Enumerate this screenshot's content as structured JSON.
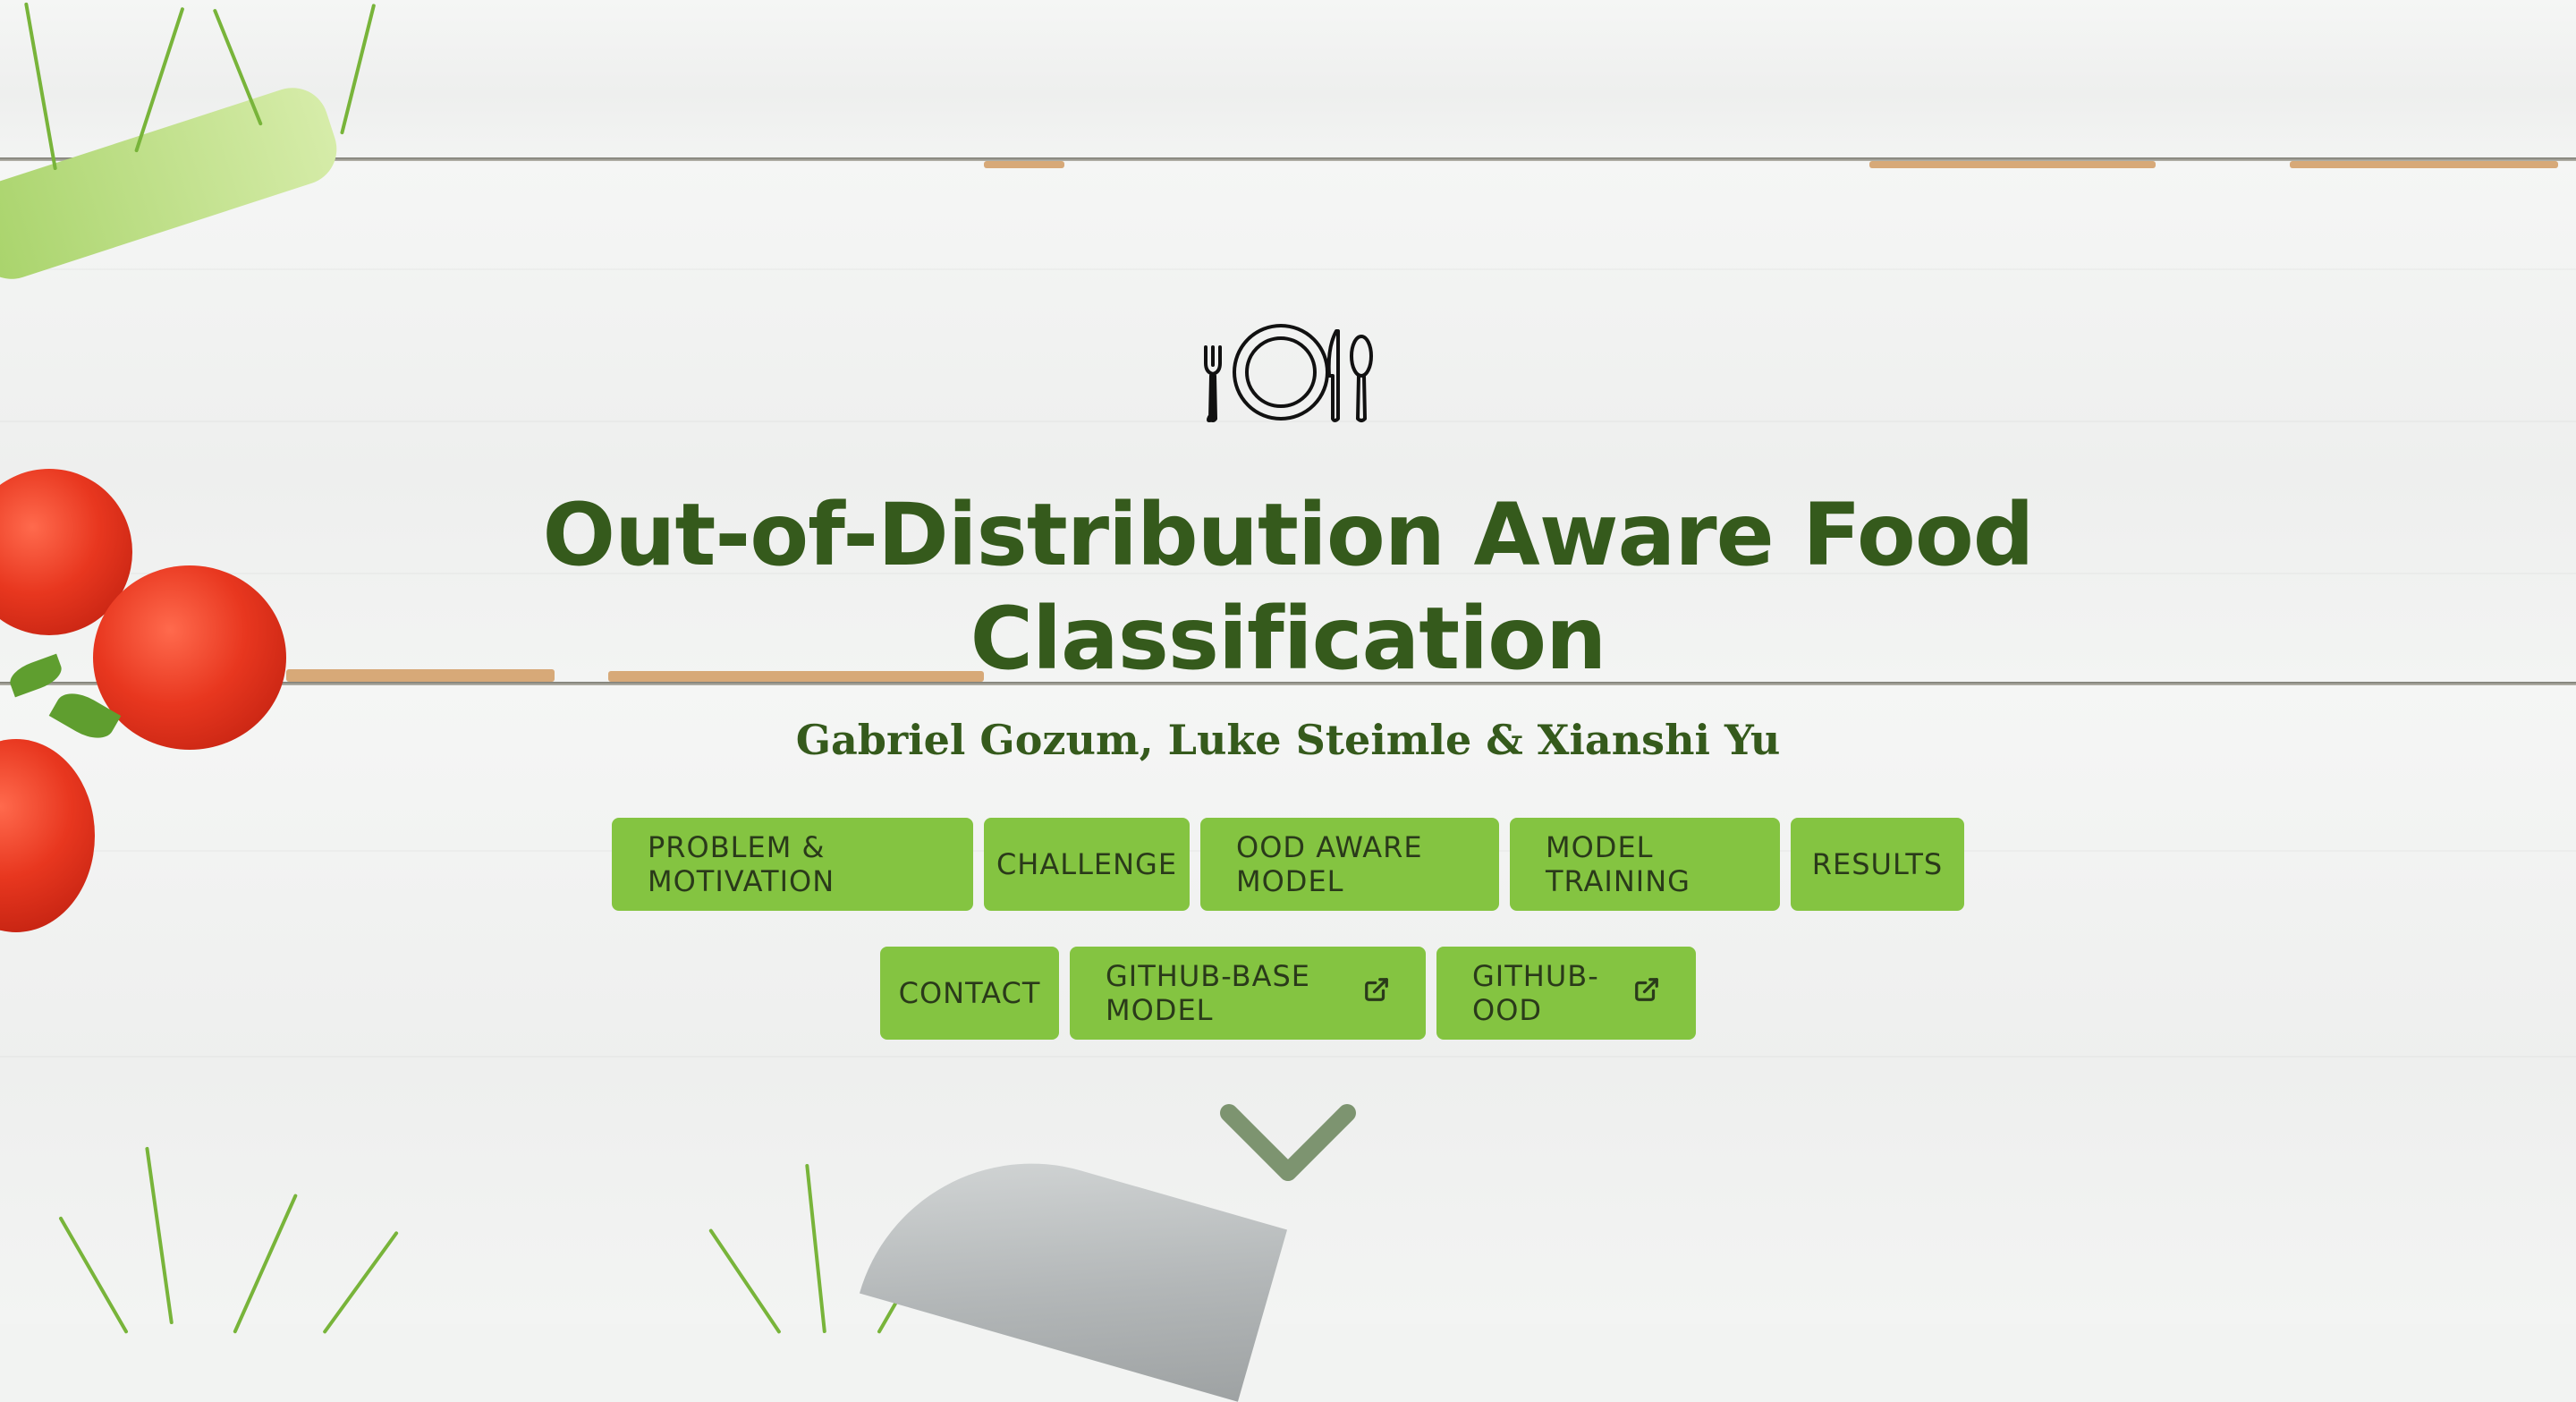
{
  "hero": {
    "logo_icon": "plate-fork-spoon-icon",
    "title_line1": "Out-of-Distribution Aware Food",
    "title_line2": "Classification",
    "authors": "Gabriel Gozum, Luke Steimle & Xianshi Yu",
    "scroll_icon": "chevron-down-icon"
  },
  "nav": {
    "row1": [
      {
        "label": "PROBLEM & MOTIVATION"
      },
      {
        "label": "CHALLENGE"
      },
      {
        "label": "OOD AWARE MODEL"
      },
      {
        "label": "MODEL TRAINING"
      },
      {
        "label": "RESULTS"
      }
    ],
    "row2": [
      {
        "label": "CONTACT"
      },
      {
        "label": "GITHUB-BASE MODEL",
        "icon": "external-link-icon"
      },
      {
        "label": "GITHUB-OOD",
        "icon": "external-link-icon"
      }
    ]
  },
  "colors": {
    "title": "#355a1c",
    "button_bg": "#84c441",
    "button_text": "#2a3a1a",
    "chevron": "#7d9470"
  }
}
